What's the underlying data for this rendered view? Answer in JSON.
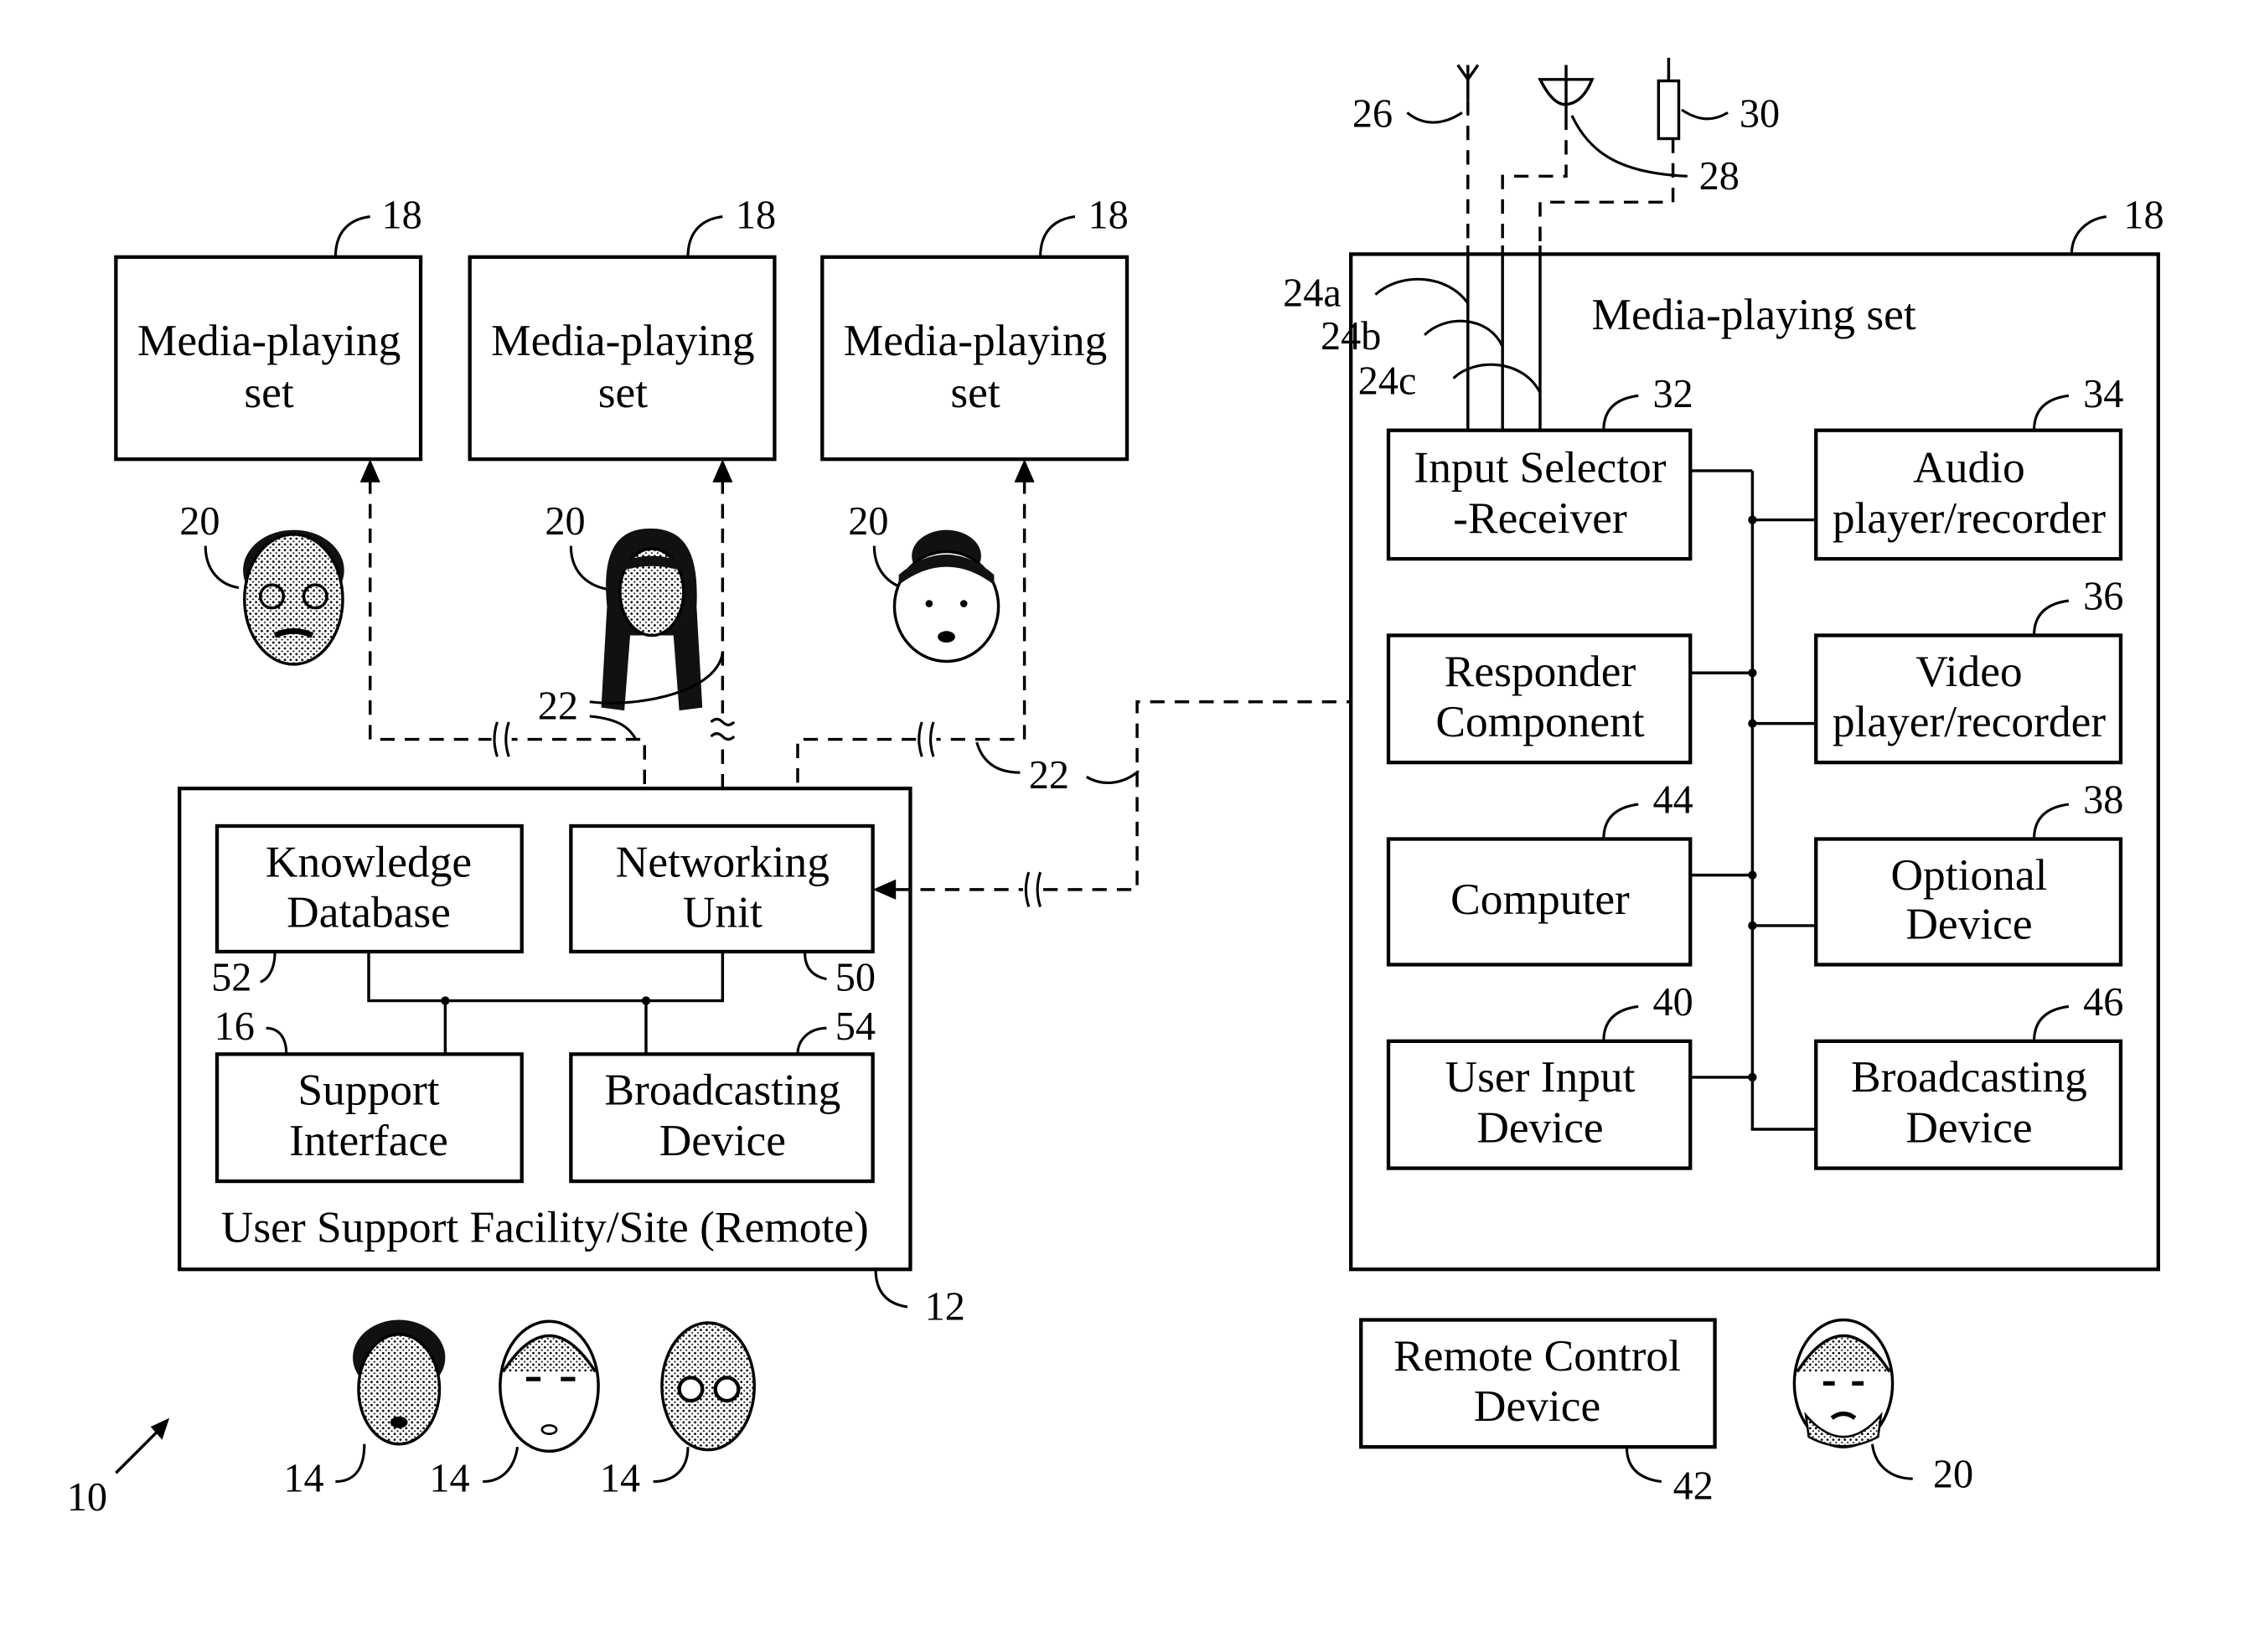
{
  "figure": {
    "system_ref": "10",
    "remote_sets": [
      {
        "label_line1": "Media-playing",
        "label_line2": "set",
        "ref": "18",
        "user_ref": "20"
      },
      {
        "label_line1": "Media-playing",
        "label_line2": "set",
        "ref": "18",
        "user_ref": "20"
      },
      {
        "label_line1": "Media-playing",
        "label_line2": "set",
        "ref": "18",
        "user_ref": "20"
      }
    ],
    "network_links_ref": "22",
    "support_facility": {
      "title": "User Support Facility/Site (Remote)",
      "ref": "12",
      "components": [
        {
          "line1": "Knowledge",
          "line2": "Database",
          "ref": "52"
        },
        {
          "line1": "Networking",
          "line2": "Unit",
          "ref": "50"
        },
        {
          "line1": "Support",
          "line2": "Interface",
          "ref": "16"
        },
        {
          "line1": "Broadcasting",
          "line2": "Device",
          "ref": "54"
        }
      ],
      "staff_refs": [
        "14",
        "14",
        "14"
      ]
    },
    "main_set": {
      "title": "Media-playing set",
      "ref": "18",
      "antennas": [
        {
          "name": "antenna",
          "ref": "26"
        },
        {
          "name": "satellite-dish",
          "ref": "28"
        },
        {
          "name": "cable",
          "ref": "30"
        }
      ],
      "inputs": [
        "24a",
        "24b",
        "24c"
      ],
      "left_components": [
        {
          "line1": "Input Selector",
          "line2": "-Receiver",
          "ref": "32"
        },
        {
          "line1": "Responder",
          "line2": "Component",
          "ref": ""
        },
        {
          "line1": "Computer",
          "line2": "",
          "ref": "44"
        },
        {
          "line1": "User Input",
          "line2": "Device",
          "ref": "40"
        }
      ],
      "right_components": [
        {
          "line1": "Audio",
          "line2": "player/recorder",
          "ref": "34"
        },
        {
          "line1": "Video",
          "line2": "player/recorder",
          "ref": "36"
        },
        {
          "line1": "Optional",
          "line2": "Device",
          "ref": "38"
        },
        {
          "line1": "Broadcasting",
          "line2": "Device",
          "ref": "46"
        }
      ]
    },
    "remote_control": {
      "line1": "Remote Control",
      "line2": "Device",
      "ref": "42"
    },
    "local_user_ref": "20"
  }
}
